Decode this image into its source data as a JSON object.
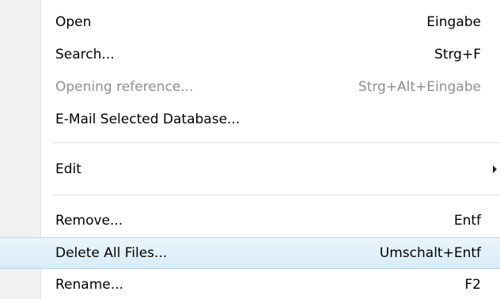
{
  "menu": {
    "items": [
      {
        "label": "Open",
        "shortcut": "Eingabe"
      },
      {
        "label": "Search...",
        "shortcut": "Strg+F"
      },
      {
        "label": "Opening reference...",
        "shortcut": "Strg+Alt+Eingabe",
        "disabled": true
      },
      {
        "label": "E-Mail Selected Database...",
        "shortcut": ""
      },
      {
        "label": "Edit",
        "shortcut": "",
        "submenu_icon": "chevron-right-icon"
      },
      {
        "label": "Remove...",
        "shortcut": "Entf"
      },
      {
        "label": "Delete All Files...",
        "shortcut": "Umschalt+Entf",
        "highlighted": true
      },
      {
        "label": "Rename...",
        "shortcut": "F2"
      }
    ]
  },
  "colors": {
    "highlight_top": "#eaf4fb",
    "highlight_bottom": "#d9ecf8",
    "highlight_border": "#b8d6ef",
    "disabled_text": "#8f8f8f"
  }
}
